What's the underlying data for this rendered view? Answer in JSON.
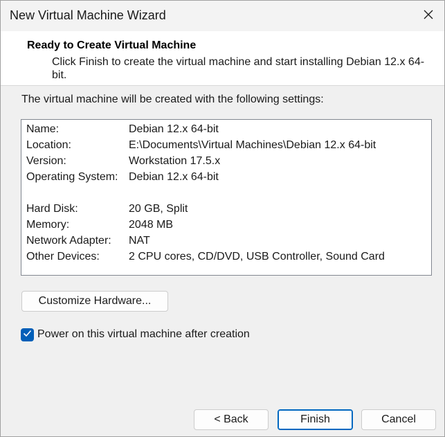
{
  "window": {
    "title": "New Virtual Machine Wizard"
  },
  "header": {
    "title": "Ready to Create Virtual Machine",
    "description": "Click Finish to create the virtual machine and start installing Debian 12.x 64-bit."
  },
  "main": {
    "intro": "The virtual machine will be created with the following settings:",
    "settings": [
      {
        "label": "Name:",
        "value": "Debian 12.x 64-bit"
      },
      {
        "label": "Location:",
        "value": "E:\\Documents\\Virtual Machines\\Debian 12.x 64-bit"
      },
      {
        "label": "Version:",
        "value": "Workstation 17.5.x"
      },
      {
        "label": "Operating System:",
        "value": "Debian 12.x 64-bit"
      },
      {
        "label": "Hard Disk:",
        "value": "20 GB, Split"
      },
      {
        "label": "Memory:",
        "value": "2048 MB"
      },
      {
        "label": "Network Adapter:",
        "value": "NAT"
      },
      {
        "label": "Other Devices:",
        "value": "2 CPU cores, CD/DVD, USB Controller, Sound Card"
      }
    ],
    "customize_label": "Customize Hardware...",
    "power_on": {
      "label": "Power on this virtual machine after creation",
      "checked": true
    }
  },
  "footer": {
    "back_label": "< Back",
    "finish_label": "Finish",
    "cancel_label": "Cancel"
  },
  "colors": {
    "accent": "#005fb8",
    "window_bg": "#f0f0f0",
    "panel_bg": "#ffffff"
  },
  "icons": {
    "close": "close-icon",
    "check": "checkmark-icon"
  }
}
